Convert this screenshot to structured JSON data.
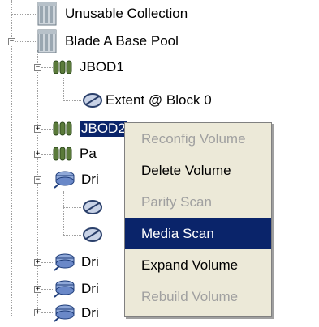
{
  "tree": {
    "nodes": [
      {
        "label": "Unusable Collection",
        "icon": "pool-stack-icon"
      },
      {
        "label": "Blade A Base Pool",
        "icon": "pool-stack-icon"
      },
      {
        "label": "JBOD1",
        "icon": "jbod-icon"
      },
      {
        "label": "Extent @ Block  0",
        "icon": "extent-disk-icon"
      },
      {
        "label": "JBOD2",
        "icon": "jbod-icon"
      },
      {
        "label": "Pa",
        "icon": "jbod-icon"
      },
      {
        "label": "Dri",
        "icon": "drive-icon"
      },
      {
        "label": "",
        "icon": "extent-disk-icon"
      },
      {
        "label": "",
        "icon": "extent-disk-icon"
      },
      {
        "label": "Dri",
        "icon": "drive-icon"
      },
      {
        "label": "Dri",
        "icon": "drive-icon"
      },
      {
        "label": "Dri",
        "icon": "drive-icon"
      }
    ]
  },
  "context_menu": {
    "items": [
      {
        "label": "Reconfig Volume",
        "enabled": false
      },
      {
        "label": "Delete Volume",
        "enabled": true
      },
      {
        "label": "Parity Scan",
        "enabled": false
      },
      {
        "label": "Media Scan",
        "enabled": true,
        "highlighted": true
      },
      {
        "label": "Expand Volume",
        "enabled": true
      },
      {
        "label": "Rebuild Volume",
        "enabled": false
      }
    ]
  },
  "colors": {
    "selection": "#0a246a",
    "menu_bg": "#ece9d8",
    "disabled": "#a0a0a0"
  }
}
